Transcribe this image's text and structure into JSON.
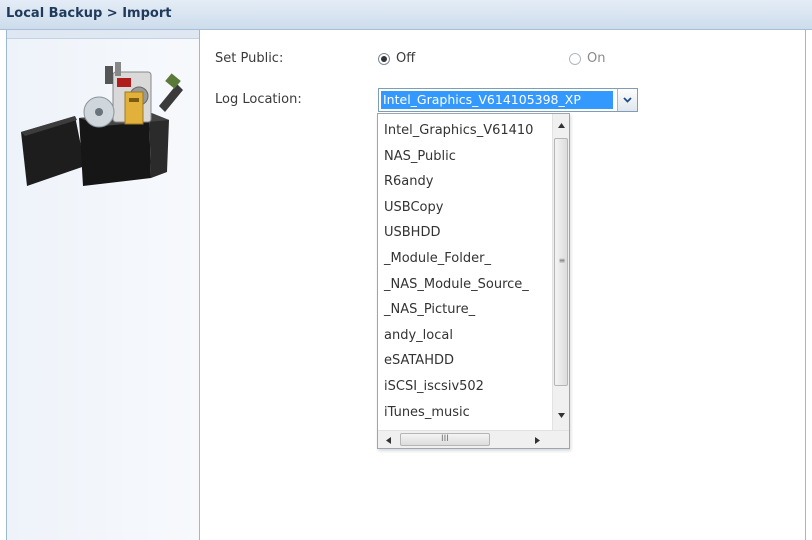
{
  "header": {
    "title": "Local Backup > Import"
  },
  "form": {
    "set_public": {
      "label": "Set Public:",
      "options": [
        {
          "label": "Off",
          "selected": true
        },
        {
          "label": "On",
          "selected": false
        }
      ]
    },
    "log_location": {
      "label": "Log Location:",
      "selected_value": "Intel_Graphics_V614105398_XP",
      "options": [
        "Intel_Graphics_V61410",
        "NAS_Public",
        "R6andy",
        "USBCopy",
        "USBHDD",
        "_Module_Folder_",
        "_NAS_Module_Source_",
        "_NAS_Picture_",
        "andy_local",
        "eSATAHDD",
        "iSCSI_iscsiv502",
        "iTunes_music"
      ]
    }
  },
  "icons": {
    "logo": "backup-box-icon",
    "combo_arrow": "chevron-down-icon",
    "scroll_up": "arrow-up-icon",
    "scroll_down": "arrow-down-icon",
    "scroll_left": "arrow-left-icon",
    "scroll_right": "arrow-right-icon",
    "scroll_grip": "grip-icon"
  },
  "colors": {
    "selection": "#3399ff",
    "title_text": "#1f3a5a",
    "header_bg": "#cddcec"
  }
}
